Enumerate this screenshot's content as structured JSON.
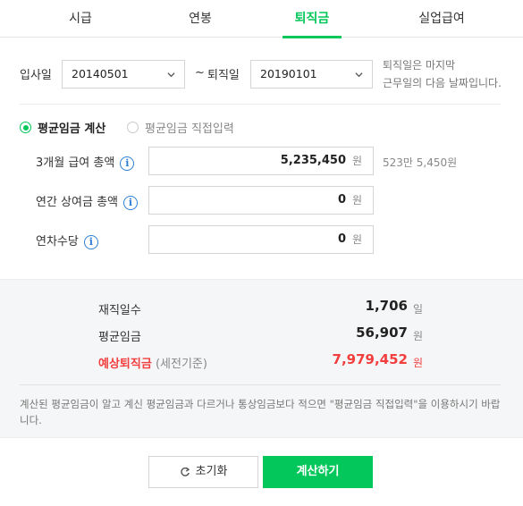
{
  "tabs": [
    "시급",
    "연봉",
    "퇴직금",
    "실업급여"
  ],
  "active_tab": "퇴직금",
  "dates": {
    "start_label": "입사일",
    "start_value": "20140501",
    "tilde": "~",
    "end_label": "퇴직일",
    "end_value": "20190101",
    "note_line1": "퇴직일은 마지막",
    "note_line2": "근무일의 다음 날짜입니다."
  },
  "method": {
    "option1": "평균임금 계산",
    "option2": "평균임금 직접입력",
    "selected": "평균임금 계산"
  },
  "inputs": [
    {
      "label": "3개월 급여 총액",
      "value": "5,235,450",
      "unit": "원",
      "hint": "523만 5,450원"
    },
    {
      "label": "연간 상여금 총액",
      "value": "0",
      "unit": "원",
      "hint": ""
    },
    {
      "label": "연차수당",
      "value": "0",
      "unit": "원",
      "hint": ""
    }
  ],
  "results": {
    "days_label": "재직일수",
    "days_value": "1,706",
    "days_unit": "일",
    "avg_label": "평균임금",
    "avg_value": "56,907",
    "avg_unit": "원",
    "sev_label": "예상퇴직금",
    "sev_sub": "(세전기준)",
    "sev_value": "7,979,452",
    "sev_unit": "원",
    "note": "계산된 평균임금이 알고 계신 평균임금과 다르거나 통상임금보다 적으면 \"평균임금 직접입력\"을 이용하시기 바랍니다."
  },
  "buttons": {
    "reset": "초기화",
    "calc": "계산하기"
  },
  "colors": {
    "accent": "#03c75a",
    "warn": "#f23e3e",
    "info": "#2d7fd6"
  }
}
